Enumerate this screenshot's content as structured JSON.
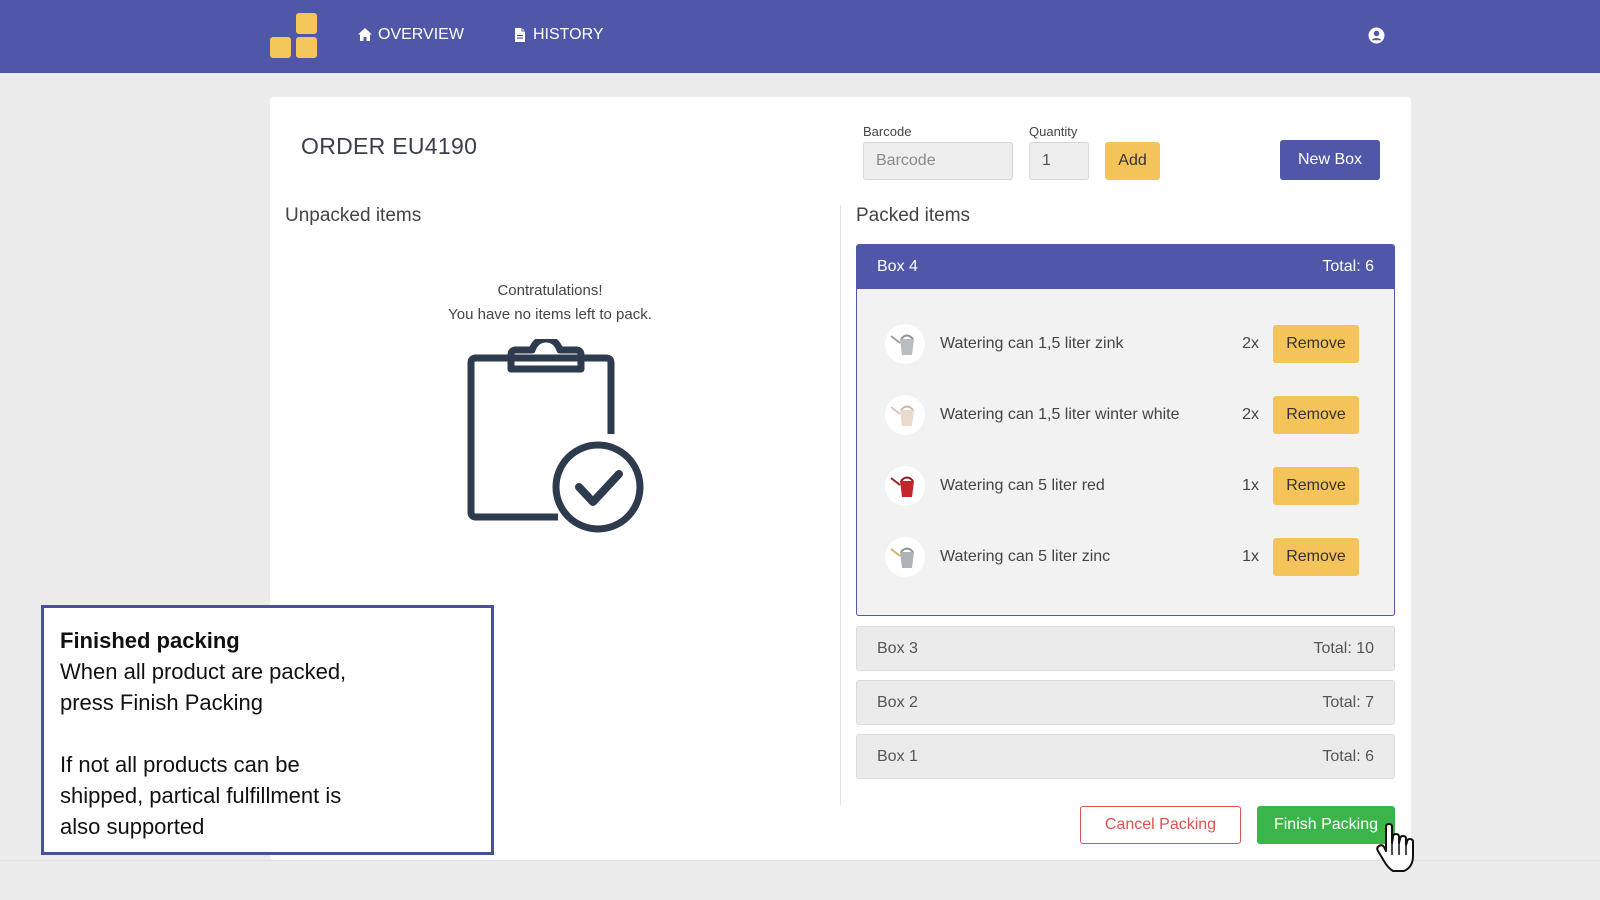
{
  "nav": {
    "overview_label": "OVERVIEW",
    "history_label": "HISTORY",
    "brand_color": "#5057a8",
    "logo_color": "#f3c75a"
  },
  "order": {
    "title": "ORDER EU4190"
  },
  "form": {
    "barcode_label": "Barcode",
    "barcode_placeholder": "Barcode",
    "quantity_label": "Quantity",
    "quantity_value": "1",
    "add_label": "Add",
    "new_box_label": "New Box"
  },
  "unpacked": {
    "title": "Unpacked items",
    "congrats_line1": "Contratulations!",
    "congrats_line2": "You have no items left to pack."
  },
  "packed": {
    "title": "Packed items",
    "open_box": {
      "name": "Box 4",
      "total": "Total: 6",
      "items": [
        {
          "name": "Watering can 1,5 liter zink",
          "qty": "2x",
          "remove_label": "Remove",
          "icon": "watering-can-zinc-icon"
        },
        {
          "name": "Watering can 1,5 liter winter white",
          "qty": "2x",
          "remove_label": "Remove",
          "icon": "watering-can-white-icon"
        },
        {
          "name": "Watering can 5 liter red",
          "qty": "1x",
          "remove_label": "Remove",
          "icon": "watering-can-red-icon"
        },
        {
          "name": "Watering can 5 liter zinc",
          "qty": "1x",
          "remove_label": "Remove",
          "icon": "watering-can-zinc-large-icon"
        }
      ]
    },
    "closed_boxes": [
      {
        "name": "Box 3",
        "total": "Total: 10"
      },
      {
        "name": "Box 2",
        "total": "Total: 7"
      },
      {
        "name": "Box 1",
        "total": "Total: 6"
      }
    ]
  },
  "actions": {
    "cancel_label": "Cancel Packing",
    "finish_label": "Finish Packing"
  },
  "callout": {
    "title": "Finished packing",
    "body1": "When all product are packed,\npress Finish Packing",
    "body2": "If not all products can be\nshipped, partical fulfillment is\nalso supported"
  }
}
